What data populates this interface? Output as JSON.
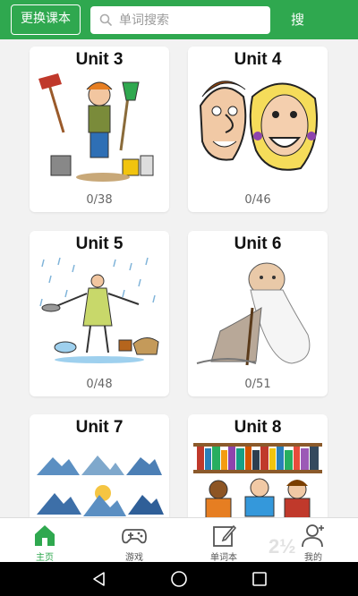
{
  "topbar": {
    "change_button": "更换课本",
    "search_placeholder": "单词搜索",
    "search_button": "搜 索"
  },
  "units": [
    {
      "title": "Unit 3",
      "progress": "0/38"
    },
    {
      "title": "Unit 4",
      "progress": "0/46"
    },
    {
      "title": "Unit 5",
      "progress": "0/48"
    },
    {
      "title": "Unit 6",
      "progress": "0/51"
    },
    {
      "title": "Unit 7",
      "progress": ""
    },
    {
      "title": "Unit 8",
      "progress": ""
    }
  ],
  "tabs": [
    {
      "label": "主页",
      "icon": "home-icon",
      "active": true
    },
    {
      "label": "游戏",
      "icon": "gamepad-icon",
      "active": false
    },
    {
      "label": "单词本",
      "icon": "notebook-edit-icon",
      "active": false
    },
    {
      "label": "我的",
      "icon": "user-icon",
      "active": false
    }
  ],
  "colors": {
    "brand": "#2fa84f"
  },
  "watermark": "2½"
}
